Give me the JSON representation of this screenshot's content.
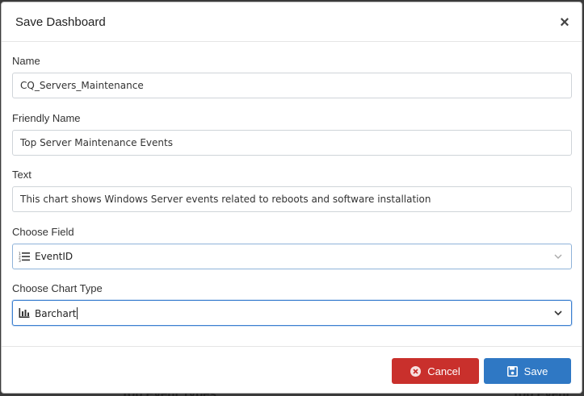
{
  "background": {
    "left_text": "Top Event Types",
    "right_text": "Top Event"
  },
  "dialog": {
    "title": "Save Dashboard",
    "close_icon": "close-icon"
  },
  "form": {
    "name": {
      "label": "Name",
      "value": "CQ_Servers_Maintenance"
    },
    "friendly_name": {
      "label": "Friendly Name",
      "value": "Top Server Maintenance Events"
    },
    "text": {
      "label": "Text",
      "value": "This chart shows Windows Server events related to reboots and software installation"
    },
    "choose_field": {
      "label": "Choose Field",
      "value": "EventID",
      "icon": "list-icon"
    },
    "choose_chart_type": {
      "label": "Choose Chart Type",
      "value": "Barchart",
      "icon": "bar-chart-icon"
    }
  },
  "footer": {
    "cancel_label": "Cancel",
    "save_label": "Save"
  },
  "colors": {
    "cancel": "#c9302c",
    "save": "#2f78c4",
    "focus": "#3b7fd0"
  }
}
